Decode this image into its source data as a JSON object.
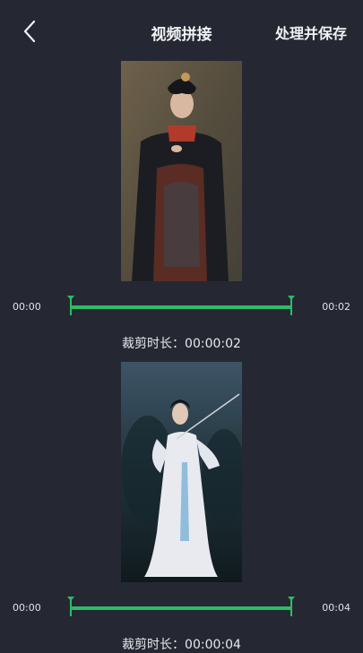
{
  "header": {
    "back_icon": "chevron-left-icon",
    "title": "视频拼接",
    "save_label": "处理并保存"
  },
  "duration_label": "裁剪时长：",
  "colors": {
    "background": "#252833",
    "accent": "#2dbb63",
    "text": "#f2f2f5"
  },
  "clips": [
    {
      "start_time": "00:00",
      "end_time": "00:02",
      "duration": "00:00:02",
      "trim_start": 0,
      "trim_end": 1
    },
    {
      "start_time": "00:00",
      "end_time": "00:04",
      "duration": "00:00:04",
      "trim_start": 0,
      "trim_end": 1
    }
  ]
}
